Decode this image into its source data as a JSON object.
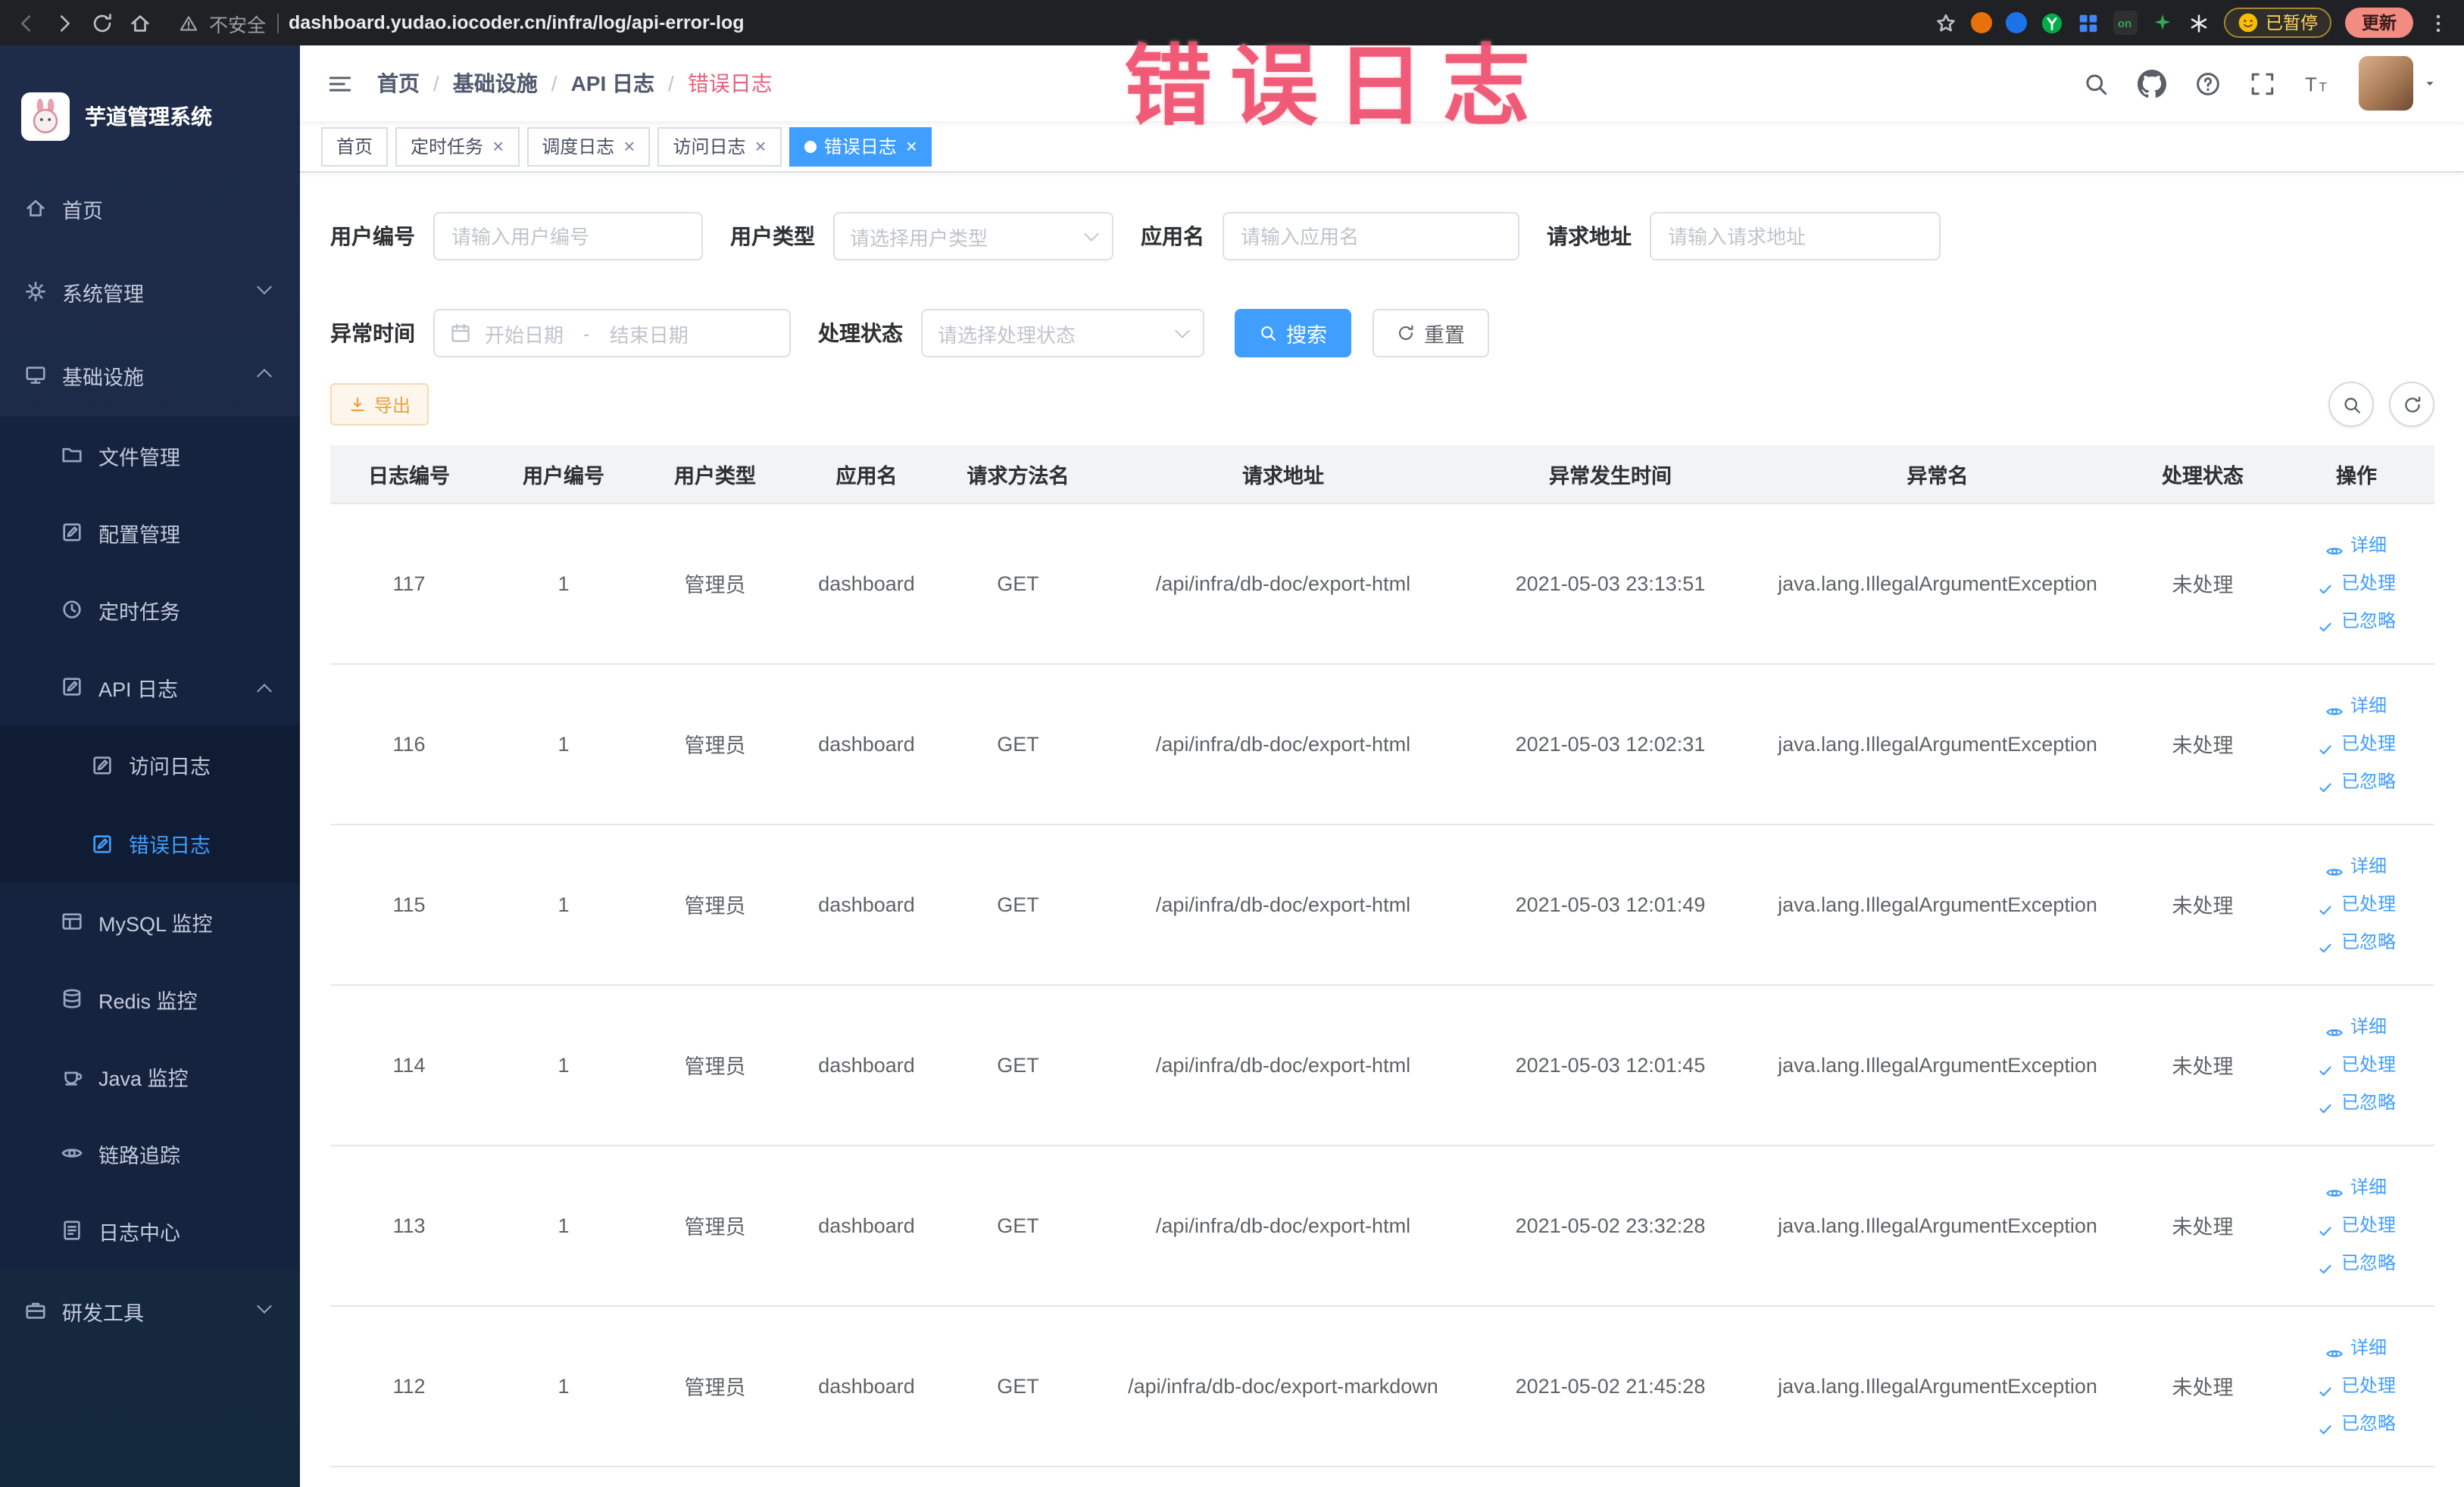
{
  "colors": {
    "accent": "#409eff",
    "warning": "#e6a23c",
    "annotation": "#ee4969",
    "sidebar_bg": "#1e2c4a"
  },
  "browser": {
    "security_label": "不安全",
    "url": "dashboard.yudao.iocoder.cn/infra/log/api-error-log",
    "extension_on_badge": "on",
    "paused_badge": "已暂停",
    "update_button": "更新"
  },
  "annotation": {
    "text": "错误日志"
  },
  "sidebar": {
    "logo_title": "芋道管理系统",
    "items": [
      {
        "key": "home",
        "label": "首页",
        "icon": "home-icon",
        "level": 1
      },
      {
        "key": "system",
        "label": "系统管理",
        "icon": "gear-icon",
        "level": 1,
        "arrow": "down"
      },
      {
        "key": "infra",
        "label": "基础设施",
        "icon": "infra-icon",
        "level": 1,
        "arrow": "up"
      },
      {
        "key": "file",
        "label": "文件管理",
        "icon": "folder-icon",
        "level": 2
      },
      {
        "key": "config",
        "label": "配置管理",
        "icon": "edit-icon",
        "level": 2
      },
      {
        "key": "job",
        "label": "定时任务",
        "icon": "clock-icon",
        "level": 2
      },
      {
        "key": "api-log",
        "label": "API 日志",
        "icon": "edit-icon",
        "level": 2,
        "arrow": "up"
      },
      {
        "key": "access-log",
        "label": "访问日志",
        "icon": "edit-icon",
        "level": 3
      },
      {
        "key": "error-log",
        "label": "错误日志",
        "icon": "edit-icon",
        "level": 3,
        "active": true
      },
      {
        "key": "mysql",
        "label": "MySQL 监控",
        "icon": "table-icon",
        "level": 2
      },
      {
        "key": "redis",
        "label": "Redis 监控",
        "icon": "db-icon",
        "level": 2
      },
      {
        "key": "java",
        "label": "Java 监控",
        "icon": "coffee-icon",
        "level": 2
      },
      {
        "key": "trace",
        "label": "链路追踪",
        "icon": "eye-icon",
        "level": 2
      },
      {
        "key": "log-center",
        "label": "日志中心",
        "icon": "doc-icon",
        "level": 2
      },
      {
        "key": "dev-tools",
        "label": "研发工具",
        "icon": "briefcase-icon",
        "level": 1,
        "arrow": "down"
      }
    ]
  },
  "breadcrumb": {
    "separator": "/",
    "items": [
      "首页",
      "基础设施",
      "API 日志",
      "错误日志"
    ]
  },
  "tabs": [
    {
      "label": "首页",
      "closable": false,
      "active": false
    },
    {
      "label": "定时任务",
      "closable": true,
      "active": false
    },
    {
      "label": "调度日志",
      "closable": true,
      "active": false
    },
    {
      "label": "访问日志",
      "closable": true,
      "active": false
    },
    {
      "label": "错误日志",
      "closable": true,
      "active": true
    }
  ],
  "filters": {
    "user_id_label": "用户编号",
    "user_id_placeholder": "请输入用户编号",
    "user_type_label": "用户类型",
    "user_type_placeholder": "请选择用户类型",
    "app_name_label": "应用名",
    "app_name_placeholder": "请输入应用名",
    "request_url_label": "请求地址",
    "request_url_placeholder": "请输入请求地址",
    "time_label": "异常时间",
    "time_start_placeholder": "开始日期",
    "time_range_separator": "-",
    "time_end_placeholder": "结束日期",
    "status_label": "处理状态",
    "status_placeholder": "请选择处理状态",
    "search_button": "搜索",
    "reset_button": "重置"
  },
  "toolbar": {
    "export_button": "导出"
  },
  "table": {
    "headers": [
      "日志编号",
      "用户编号",
      "用户类型",
      "应用名",
      "请求方法名",
      "请求地址",
      "异常发生时间",
      "异常名",
      "处理状态",
      "操作"
    ],
    "action_labels": [
      "详细",
      "已处理",
      "已忽略"
    ],
    "rows": [
      {
        "log_id": "117",
        "user_id": "1",
        "user_type": "管理员",
        "app_name": "dashboard",
        "method": "GET",
        "request_url": "/api/infra/db-doc/export-html",
        "exception_time": "2021-05-03 23:13:51",
        "exception_name": "java.lang.IllegalArgumentException",
        "status": "未处理"
      },
      {
        "log_id": "116",
        "user_id": "1",
        "user_type": "管理员",
        "app_name": "dashboard",
        "method": "GET",
        "request_url": "/api/infra/db-doc/export-html",
        "exception_time": "2021-05-03 12:02:31",
        "exception_name": "java.lang.IllegalArgumentException",
        "status": "未处理"
      },
      {
        "log_id": "115",
        "user_id": "1",
        "user_type": "管理员",
        "app_name": "dashboard",
        "method": "GET",
        "request_url": "/api/infra/db-doc/export-html",
        "exception_time": "2021-05-03 12:01:49",
        "exception_name": "java.lang.IllegalArgumentException",
        "status": "未处理"
      },
      {
        "log_id": "114",
        "user_id": "1",
        "user_type": "管理员",
        "app_name": "dashboard",
        "method": "GET",
        "request_url": "/api/infra/db-doc/export-html",
        "exception_time": "2021-05-03 12:01:45",
        "exception_name": "java.lang.IllegalArgumentException",
        "status": "未处理"
      },
      {
        "log_id": "113",
        "user_id": "1",
        "user_type": "管理员",
        "app_name": "dashboard",
        "method": "GET",
        "request_url": "/api/infra/db-doc/export-html",
        "exception_time": "2021-05-02 23:32:28",
        "exception_name": "java.lang.IllegalArgumentException",
        "status": "未处理"
      },
      {
        "log_id": "112",
        "user_id": "1",
        "user_type": "管理员",
        "app_name": "dashboard",
        "method": "GET",
        "request_url": "/api/infra/db-doc/export-markdown",
        "exception_time": "2021-05-02 21:45:28",
        "exception_name": "java.lang.IllegalArgumentException",
        "status": "未处理"
      }
    ]
  }
}
